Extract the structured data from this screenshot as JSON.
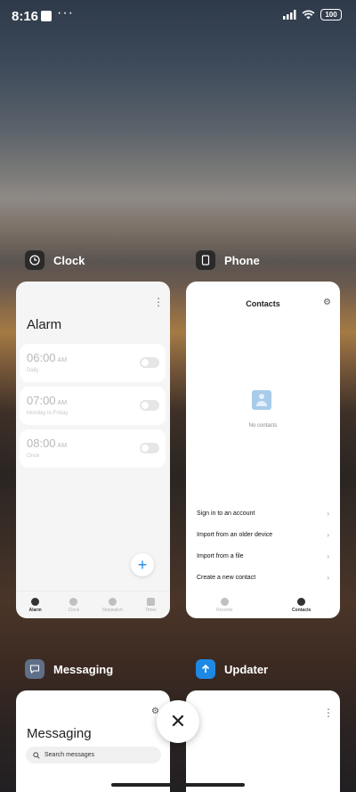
{
  "status": {
    "time": "8:16",
    "battery": "100",
    "more": "···"
  },
  "apps": [
    {
      "name": "Clock"
    },
    {
      "name": "Phone"
    },
    {
      "name": "Messaging"
    },
    {
      "name": "Updater"
    }
  ],
  "clock": {
    "title": "Alarm",
    "alarms": [
      {
        "time": "06:00",
        "ampm": "AM",
        "sub": "Daily"
      },
      {
        "time": "07:00",
        "ampm": "AM",
        "sub": "Monday to Friday"
      },
      {
        "time": "08:00",
        "ampm": "AM",
        "sub": "Once"
      }
    ],
    "tabs": [
      "Alarm",
      "Clock",
      "Stopwatch",
      "Timer"
    ],
    "fab": "+"
  },
  "phone": {
    "title": "Contacts",
    "empty": "No contacts",
    "options": [
      "Sign in to an account",
      "Import from an older device",
      "Import from a file",
      "Create a new contact"
    ],
    "tabs": [
      "Recents",
      "Contacts"
    ]
  },
  "messaging": {
    "title": "Messaging",
    "search_placeholder": "Search messages"
  },
  "close": "✕",
  "colors": {
    "accent": "#1e88e5",
    "updater_icon": "#1e88e5"
  }
}
